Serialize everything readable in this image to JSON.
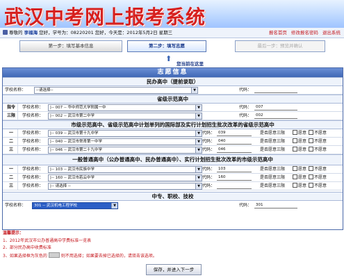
{
  "app": {
    "title": "武汉中考网上报考系统"
  },
  "userbar": {
    "greeting_prefix": "尊敬的",
    "student_name": "李福海",
    "greeting_suffix": "您好，学号为：08220201  您好，今天是：2012年5月2日 星期三",
    "links": [
      "报名首页",
      "修改报名密码",
      "退出系统"
    ]
  },
  "steps": {
    "step1": "第一步：填写基本信息",
    "step2": "第二步：填写志愿",
    "step3": "最后一步：预览并确认",
    "here_label": "您当前在这里"
  },
  "form": {
    "title": "志愿信息",
    "minban": {
      "header": "民办高中（提前录取）",
      "school_label": "学校名称：",
      "school_value": "--请选择--",
      "code_label": "代码："
    },
    "shengji": {
      "header": "省级示范高中",
      "zhiyu_label": "指令",
      "sanxian_label": "三限",
      "rows": [
        {
          "school_label": "学校名称：",
          "school": "|-- 007 -- 华中师范大学附属一中",
          "code_label": "代码：",
          "code": "007"
        },
        {
          "school_label": "学校名称：",
          "school": "|-- 002 -- 武汉市第二中学",
          "code_label": "代码：",
          "code": "002"
        }
      ]
    },
    "shifan": {
      "header": "市级示范高中、省级示范高中计划单列的国际部及实行计划招生批次改革的省级示范高中",
      "rows": [
        {
          "index": "一",
          "school_label": "学校名称：",
          "school": "|-- 039 -- 武汉市第十九中学",
          "code_label": "代码：",
          "code": "039",
          "obey": "是否愿意三限",
          "yes": "愿意",
          "no": "不愿意"
        },
        {
          "index": "二",
          "school_label": "学校名称：",
          "school": "|-- 040 -- 武汉市常青第一中学",
          "code_label": "代码：",
          "code": "040",
          "obey": "是否愿意三限",
          "yes": "愿意",
          "no": "不愿意"
        },
        {
          "index": "三",
          "school_label": "学校名称：",
          "school": "|-- 046 -- 武汉市第二十九中学",
          "code_label": "代码：",
          "code": "046",
          "obey": "是否愿意三限",
          "yes": "愿意",
          "no": "不愿意"
        }
      ]
    },
    "putong": {
      "header": "一般普通高中（公办普通高中、民办普通高中）、实行计划招生批次改革的市级示范高中",
      "rows": [
        {
          "index": "一",
          "school_label": "学校名称：",
          "school": "|-- 103 -- 武汉市民族中学",
          "code_label": "代码：",
          "code": "103",
          "obey": "是否愿意三限",
          "yes": "愿意",
          "no": "不愿意"
        },
        {
          "index": "二",
          "school_label": "学校名称：",
          "school": "|-- 160 -- 武汉市若云中学",
          "code_label": "代码：",
          "code": "160",
          "obey": "是否愿意三限",
          "yes": "愿意",
          "no": "不愿意"
        },
        {
          "index": "三",
          "school_label": "学校名称：",
          "school": "|-- 请选择 --",
          "code_label": "代码：",
          "code": "",
          "obey": "是否愿意三限",
          "yes": "愿意",
          "no": "不愿意"
        }
      ]
    },
    "zhongzhuan": {
      "header": "中专、职校、技校",
      "school_label": "学校名称：",
      "school": "301 -- 武汉机电工程学校",
      "code_label": "代码：",
      "code": "301"
    }
  },
  "tips": {
    "title": "温馨提示：",
    "items": [
      "1、2012年武汉市公办普通高中学费标准一览表",
      "2、部分民办高中收费标准",
      "3、如果选择框为灰色的",
      "则不用选择；如果要去掉已选择的，请双击该选项。"
    ]
  },
  "save_button": "保存，并进入下一步",
  "colors": {
    "accent": "#3f67b5",
    "title_red": "#d7201e",
    "selected": "#2c5fc6"
  }
}
